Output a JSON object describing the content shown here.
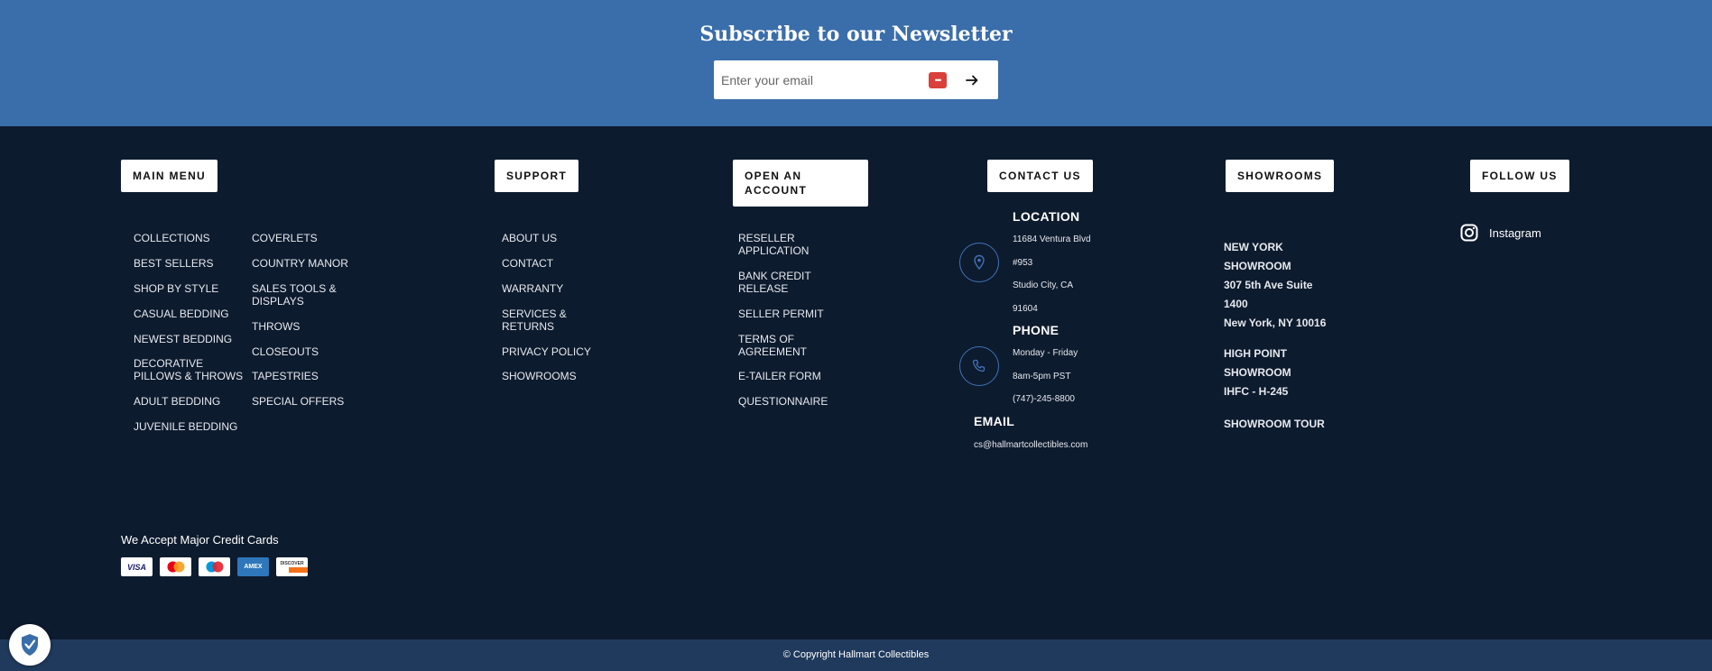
{
  "newsletter": {
    "title": "Subscribe to our Newsletter",
    "placeholder": "Enter your email"
  },
  "headings": {
    "main_menu": "MAIN MENU",
    "support": "SUPPORT",
    "open_account": "OPEN AN\nACCOUNT",
    "contact": "CONTACT US",
    "showrooms": "SHOWROOMS",
    "follow": "FOLLOW US"
  },
  "main_menu": {
    "col1": [
      "COLLECTIONS",
      "BEST SELLERS",
      "SHOP BY STYLE",
      "CASUAL BEDDING",
      "NEWEST BEDDING",
      "DECORATIVE\nPILLOWS & THROWS",
      "ADULT BEDDING",
      "JUVENILE BEDDING"
    ],
    "col2": [
      "COVERLETS",
      "COUNTRY MANOR",
      "SALES TOOLS &\nDISPLAYS",
      "THROWS",
      "CLOSEOUTS",
      "TAPESTRIES",
      "SPECIAL OFFERS"
    ]
  },
  "support": [
    "ABOUT US",
    "CONTACT",
    "WARRANTY",
    "SERVICES &\nRETURNS",
    "PRIVACY POLICY",
    "SHOWROOMS"
  ],
  "account": [
    "RESELLER\nAPPLICATION",
    "BANK CREDIT\nRELEASE",
    "SELLER PERMIT",
    "TERMS OF\nAGREEMENT",
    "E-TAILER FORM",
    "QUESTIONNAIRE"
  ],
  "contact": {
    "location_title": "LOCATION",
    "location_lines": [
      "11684 Ventura Blvd",
      "#953",
      "Studio City, CA",
      "91604"
    ],
    "phone_title": "PHONE",
    "phone_lines": [
      "Monday - Friday",
      "8am-5pm PST",
      "(747)-245-8800"
    ],
    "email_title": "EMAIL",
    "email": "cs@hallmartcollectibles.com"
  },
  "showrooms": {
    "new_york": "NEW YORK\nSHOWROOM\n307 5th Ave Suite\n1400\nNew York, NY 10016",
    "high_point": "HIGH POINT\nSHOWROOM\nIHFC - H-245",
    "tour": "SHOWROOM TOUR"
  },
  "follow": {
    "instagram": "Instagram"
  },
  "payments": {
    "title": "We Accept Major Credit Cards",
    "visa": "VISA",
    "amex": "AMEX",
    "discover": "DISCOVER"
  },
  "footer": {
    "copyright": "© Copyright Hallmart Collectibles"
  },
  "colors": {
    "newsletter_bg": "#3a6eaa",
    "page_bg": "#0d1b2e",
    "footer_bg": "#1f3a5c",
    "icon_accent": "#3f73b8"
  }
}
